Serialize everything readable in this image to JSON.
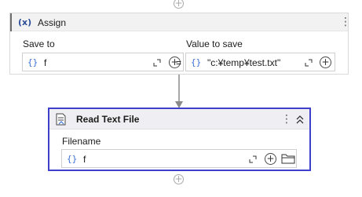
{
  "assign": {
    "title": "Assign",
    "icon_text": "(x)",
    "left_label": "Save to",
    "left_prefix": "{}",
    "left_value": "f",
    "equals": "=",
    "right_label": "Value to save",
    "right_prefix": "{}",
    "right_value": "\"c:¥temp¥test.txt\""
  },
  "read_text_file": {
    "title": "Read Text File",
    "field_label": "Filename",
    "prefix": "{}",
    "value": "f"
  },
  "icons": {
    "add": "add-circle-icon",
    "kebab": "more-vertical-icon",
    "collapse": "double-chevron-up-icon",
    "expand": "expand-corner-icon",
    "folder": "folder-icon"
  },
  "colors": {
    "selection_border": "#3f3fce",
    "prefix_blue": "#3b6fd6"
  }
}
